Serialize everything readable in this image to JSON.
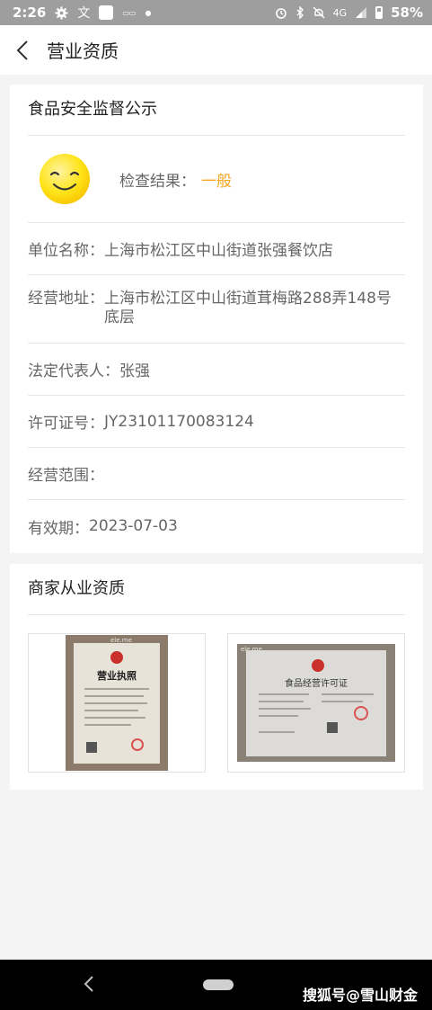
{
  "status_bar": {
    "time": "2:26",
    "network": "4G",
    "battery": "58%",
    "left_icons": [
      "gear-icon",
      "translate-icon",
      "app-icon",
      "mini-app-icon",
      "dot-icon"
    ],
    "right_icons": [
      "alarm-icon",
      "bluetooth-icon",
      "mute-icon",
      "signal-icon",
      "battery-icon"
    ]
  },
  "header": {
    "title": "营业资质",
    "back_icon": "chevron-left-icon"
  },
  "safety_card": {
    "title": "食品安全监督公示",
    "check_label": "检查结果：",
    "check_value": "一般",
    "check_value_color": "#f5a623",
    "fields": [
      {
        "label": "单位名称：",
        "value": "上海市松江区中山街道张强餐饮店"
      },
      {
        "label": "经营地址：",
        "value": "上海市松江区中山街道茸梅路288弄148号底层"
      },
      {
        "label": "法定代表人：",
        "value": "张强"
      },
      {
        "label": "许可证号：",
        "value": "JY23101170083124"
      },
      {
        "label": "经营范围：",
        "value": ""
      },
      {
        "label": "有效期：",
        "value": "2023-07-03"
      }
    ]
  },
  "qualification_card": {
    "title": "商家从业资质",
    "images": [
      {
        "title": "营业执照",
        "watermark": "ele.me"
      },
      {
        "title": "食品经营许可证",
        "watermark": "ele.me"
      }
    ]
  },
  "nav_bar": {
    "back_icon": "back-triangle-icon",
    "home_icon": "home-pill-icon"
  },
  "watermark": "搜狐号@雪山财金"
}
